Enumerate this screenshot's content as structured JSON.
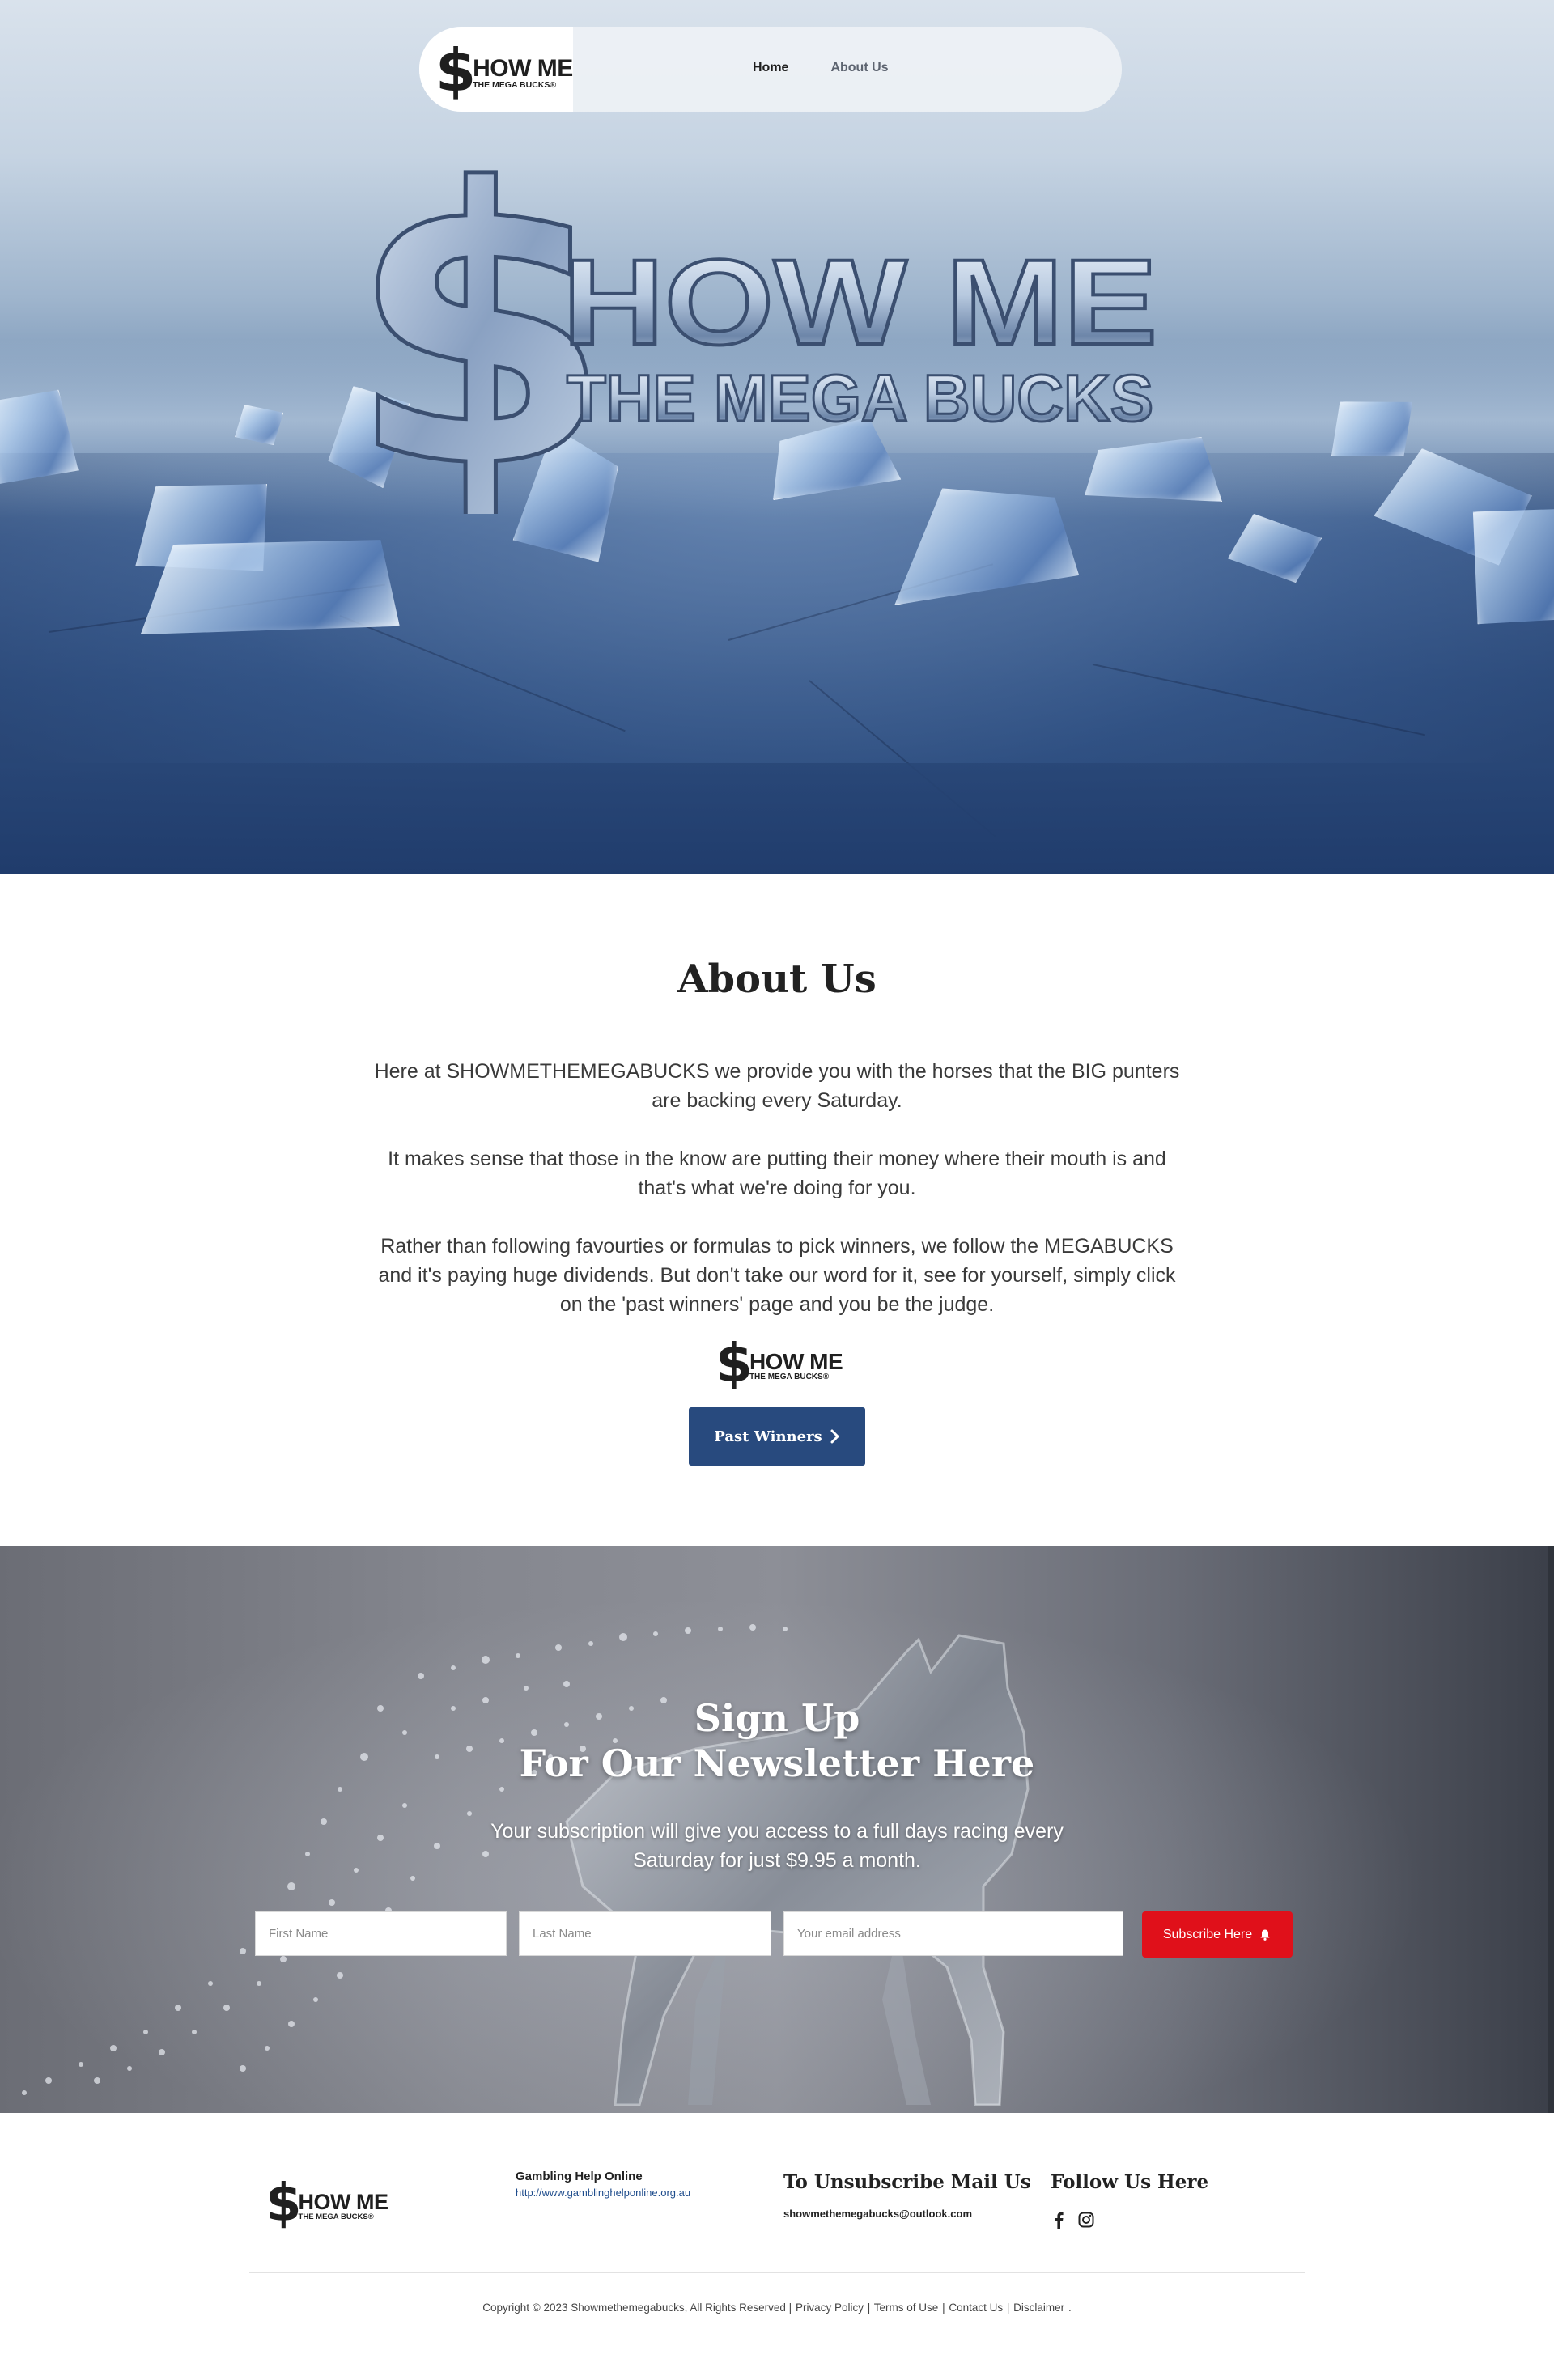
{
  "brand": {
    "logo_line1": "HOW ME",
    "logo_line2": "THE MEGA BUCKS",
    "logo_symbol": "$",
    "trademark": "®"
  },
  "nav": {
    "items": [
      {
        "label": "Home",
        "active": true
      },
      {
        "label": "About Us",
        "active": false
      }
    ]
  },
  "about": {
    "title": "About Us",
    "paragraphs": [
      "Here at SHOWMETHEMEGABUCKS we provide you with the horses that the BIG punters are backing every Saturday.",
      "It makes sense that those in the know are putting their money where their mouth is and that's what we're doing for you.",
      "Rather than following favourties or formulas to pick winners, we follow the MEGABUCKS and it's paying huge dividends. But don't take our word for it, see for yourself, simply click on the 'past winners' page and you be the judge."
    ],
    "button_label": "Past Winners",
    "button_icon": "chevron-right-icon"
  },
  "newsletter": {
    "title_line1": "Sign Up",
    "title_line2": "For Our Newsletter Here",
    "subtitle": "Your subscription will give you access to a full days racing every Saturday for just $9.95 a month.",
    "first_name_placeholder": "First Name",
    "last_name_placeholder": "Last Name",
    "email_placeholder": "Your email address",
    "button_label": "Subscribe Here",
    "button_icon": "bell-icon",
    "button_color": "#e0101a"
  },
  "footer": {
    "gambling_help_title": "Gambling Help Online",
    "gambling_help_link": "http://www.gamblinghelponline.org.au",
    "unsubscribe_title": "To Unsubscribe Mail Us",
    "unsubscribe_email": "showmethemegabucks@outlook.com",
    "follow_title": "Follow Us Here",
    "social_icons": [
      "facebook-icon",
      "instagram-icon"
    ],
    "copyright": "Copyright © 2023 Showmethemegabucks, All Rights Reserved |",
    "links": [
      "Privacy Policy",
      "Terms of Use",
      "Contact Us",
      "Disclaimer"
    ],
    "separator": "|",
    "trailing": "."
  },
  "colors": {
    "primary_button": "#284a7e",
    "subscribe_button": "#e0101a",
    "link": "#1e4c8c"
  }
}
